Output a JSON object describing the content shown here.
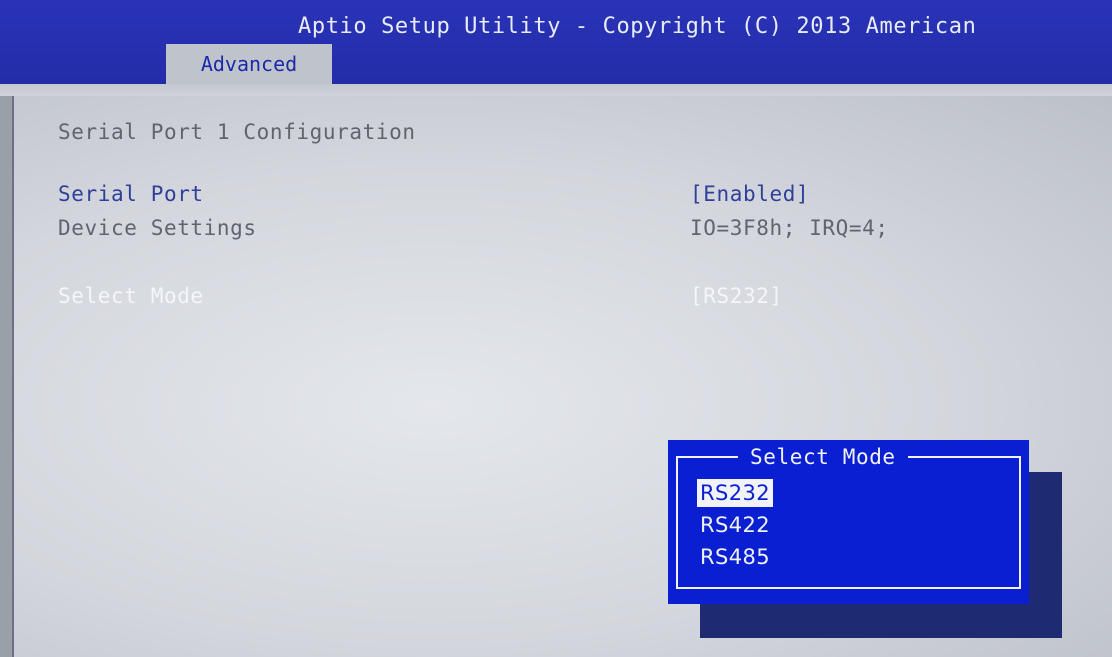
{
  "header": {
    "title": "Aptio Setup Utility - Copyright (C) 2013 American",
    "active_tab": "Advanced"
  },
  "main": {
    "section_title": "Serial Port 1 Configuration",
    "settings": [
      {
        "label": "Serial Port",
        "value": "[Enabled]"
      },
      {
        "label": "Device Settings",
        "value": "IO=3F8h; IRQ=4;"
      },
      {
        "label": "Select Mode",
        "value": "[RS232]"
      }
    ]
  },
  "popup": {
    "title": "Select Mode",
    "options": [
      "RS232",
      "RS422",
      "RS485"
    ],
    "selected_index": 0
  },
  "colors": {
    "header_blue": "#232ca8",
    "popup_blue": "#0a1fd2",
    "highlight_white": "#f1f3f8",
    "label_blue": "#2f3f9a",
    "label_gray": "#5f6470"
  }
}
